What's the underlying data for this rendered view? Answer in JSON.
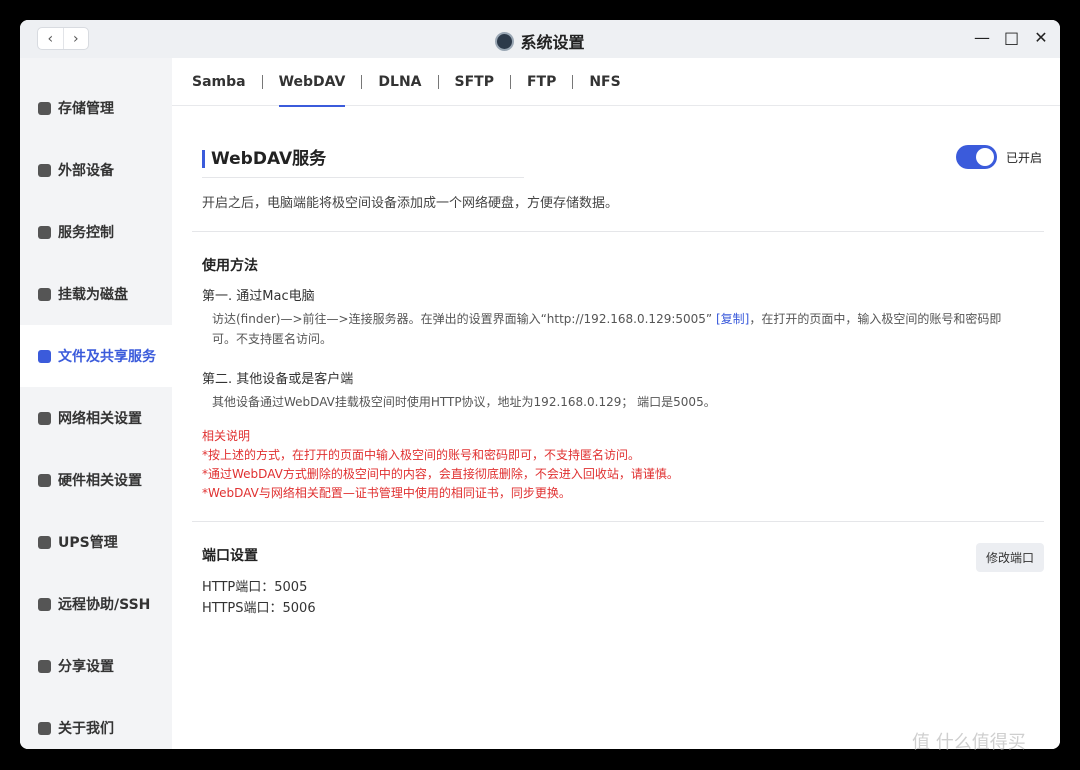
{
  "window": {
    "title": "系统设置",
    "nav_back": "‹",
    "nav_forward": "›",
    "controls": [
      "—",
      "□",
      "✕"
    ]
  },
  "sidebar": {
    "items": [
      {
        "label": "存储管理",
        "icon": "database-icon"
      },
      {
        "label": "外部设备",
        "icon": "device-icon"
      },
      {
        "label": "服务控制",
        "icon": "toggle-icon"
      },
      {
        "label": "挂载为磁盘",
        "icon": "disk-icon"
      },
      {
        "label": "文件及共享服务",
        "icon": "file-share-icon",
        "active": true
      },
      {
        "label": "网络相关设置",
        "icon": "globe-icon"
      },
      {
        "label": "硬件相关设置",
        "icon": "grid-icon"
      },
      {
        "label": "UPS管理",
        "icon": "ups-icon"
      },
      {
        "label": "远程协助/SSH",
        "icon": "terminal-icon"
      },
      {
        "label": "分享设置",
        "icon": "share-icon"
      },
      {
        "label": "关于我们",
        "icon": "info-icon"
      }
    ]
  },
  "tabs": [
    "Samba",
    "WebDAV",
    "DLNA",
    "SFTP",
    "FTP",
    "NFS"
  ],
  "active_tab": "WebDAV",
  "service": {
    "title": "WebDAV服务",
    "toggle_state": "已开启",
    "description": "开启之后，电脑端能将极空间设备添加成一个网络硬盘，方便存储数据。"
  },
  "usage": {
    "title": "使用方法",
    "mac_title": "第一. 通过Mac电脑",
    "mac_text_1": "访达(finder)—>前往—>连接服务器。在弹出的设置界面输入“http://192.168.0.129:5005”",
    "copy_link": "[复制]",
    "mac_text_2": "，在打开的页面中，输入极空间的账号和密码即",
    "mac_text_3": "可。不支持匿名访问。",
    "other_title": "第二. 其他设备或是客户端",
    "other_text": "其他设备通过WebDAV挂载极空间时使用HTTP协议，地址为192.168.0.129； 端口是5005。"
  },
  "notes": {
    "title": "相关说明",
    "lines": [
      "*按上述的方式，在打开的页面中输入极空间的账号和密码即可，不支持匿名访问。",
      "*通过WebDAV方式删除的极空间中的内容，会直接彻底删除，不会进入回收站，请谨慎。",
      "*WebDAV与网络相关配置—证书管理中使用的相同证书，同步更换。"
    ]
  },
  "ports": {
    "title": "端口设置",
    "edit_button": "修改端口",
    "http": "HTTP端口：5005",
    "https": "HTTPS端口：5006"
  },
  "watermark": "值 什么值得买"
}
